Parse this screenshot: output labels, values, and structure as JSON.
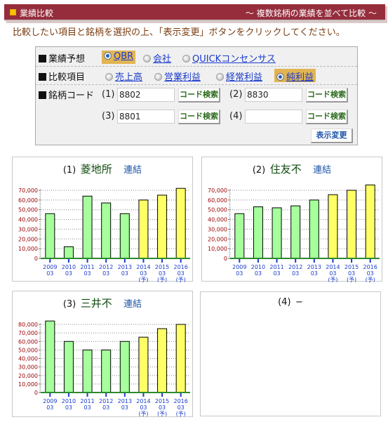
{
  "header": {
    "title": "業績比較",
    "subtitle": "～ 複数銘柄の業績を並べて比較 ～",
    "accent_color": "#952d3c"
  },
  "instruction": "比較したい項目と銘柄を選択の上、「表示変更」ボタンをクリックしてください。",
  "form": {
    "forecast": {
      "label": "業績予想",
      "options": [
        {
          "label": "QBR",
          "selected": true
        },
        {
          "label": "会社",
          "selected": false
        },
        {
          "label": "QUICKコンセンサス",
          "selected": false
        }
      ]
    },
    "metric": {
      "label": "比較項目",
      "options": [
        {
          "label": "売上高",
          "selected": false
        },
        {
          "label": "営業利益",
          "selected": false
        },
        {
          "label": "経常利益",
          "selected": false
        },
        {
          "label": "純利益",
          "selected": true
        }
      ]
    },
    "codes": {
      "label": "銘柄コード",
      "slots": [
        {
          "label": "(1)",
          "value": "8802"
        },
        {
          "label": "(2)",
          "value": "8830"
        },
        {
          "label": "(3)",
          "value": "8801"
        },
        {
          "label": "(4)",
          "value": ""
        }
      ],
      "search_button": "コード検索"
    },
    "apply_button": "表示変更"
  },
  "panels": [
    {
      "num": "(1)",
      "name": "菱地所",
      "kind": "連結"
    },
    {
      "num": "(2)",
      "name": "住友不",
      "kind": "連結"
    },
    {
      "num": "(3)",
      "name": "三井不",
      "kind": "連結"
    },
    {
      "num": "(4)",
      "name": "−",
      "kind": ""
    }
  ],
  "colors": {
    "actual_bar": "#a6ff9c",
    "forecast_bar": "#ffff66",
    "axis_label": "#990000",
    "tick_label": "#1a3bcc",
    "baseline": "#2e8b2e"
  },
  "chart_data": [
    {
      "type": "bar",
      "title": "(1) 菱地所 連結",
      "categories": [
        "2009\n03",
        "2010\n03",
        "2011\n03",
        "2012\n03",
        "2013\n03",
        "2014\n03\n(予)",
        "2015\n03\n(予)",
        "2016\n03\n(予)"
      ],
      "values": [
        46000,
        12000,
        64000,
        57000,
        46000,
        60000,
        65000,
        72000
      ],
      "forecast": [
        false,
        false,
        false,
        false,
        false,
        true,
        true,
        true
      ],
      "ylim": [
        0,
        70000
      ],
      "yticks": [
        "0",
        "10,000",
        "20,000",
        "30,000",
        "40,000",
        "50,000",
        "60,000",
        "70,000"
      ],
      "grid": true
    },
    {
      "type": "bar",
      "title": "(2) 住友不 連結",
      "categories": [
        "2009\n03",
        "2010\n03",
        "2011\n03",
        "2012\n03",
        "2013\n03",
        "2014\n03\n(予)",
        "2015\n03\n(予)",
        "2016\n03\n(予)"
      ],
      "values": [
        46000,
        53000,
        52000,
        54000,
        60000,
        65500,
        70000,
        75500
      ],
      "forecast": [
        false,
        false,
        false,
        false,
        false,
        true,
        true,
        true
      ],
      "ylim": [
        0,
        70000
      ],
      "yticks": [
        "0",
        "10,000",
        "20,000",
        "30,000",
        "40,000",
        "50,000",
        "60,000",
        "70,000"
      ],
      "grid": true
    },
    {
      "type": "bar",
      "title": "(3) 三井不 連結",
      "categories": [
        "2009\n03",
        "2010\n03",
        "2011\n03",
        "2012\n03",
        "2013\n03",
        "2014\n03\n(予)",
        "2015\n03\n(予)",
        "2016\n03\n(予)"
      ],
      "values": [
        84000,
        60000,
        50000,
        50000,
        60000,
        65000,
        75000,
        80000
      ],
      "forecast": [
        false,
        false,
        false,
        false,
        false,
        true,
        true,
        true
      ],
      "ylim": [
        0,
        80000
      ],
      "yticks": [
        "0",
        "10,000",
        "20,000",
        "30,000",
        "40,000",
        "50,000",
        "60,000",
        "70,000",
        "80,000"
      ],
      "grid": true
    }
  ]
}
